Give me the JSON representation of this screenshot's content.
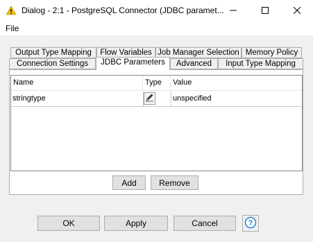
{
  "window": {
    "title": "Dialog - 2:1 - PostgreSQL Connector (JDBC paramet...",
    "minimize_icon": "minimize-icon",
    "maximize_icon": "maximize-icon",
    "close_icon": "close-icon",
    "app_icon": "warning-triangle-icon"
  },
  "menu": {
    "file": "File"
  },
  "tabs": {
    "row1": [
      "Output Type Mapping",
      "Flow Variables",
      "Job Manager Selection",
      "Memory Policy"
    ],
    "row2": [
      "Connection Settings",
      "JDBC Parameters",
      "Advanced",
      "Input Type Mapping"
    ],
    "active": "JDBC Parameters"
  },
  "table": {
    "headers": [
      "Name",
      "Type",
      "Value"
    ],
    "rows": [
      {
        "name": "stringtype",
        "type_icon": "pencil-icon",
        "value": "unspecified"
      }
    ]
  },
  "panel_buttons": {
    "add": "Add",
    "remove": "Remove"
  },
  "dialog_buttons": {
    "ok": "OK",
    "apply": "Apply",
    "cancel": "Cancel",
    "help_icon": "help-icon"
  }
}
